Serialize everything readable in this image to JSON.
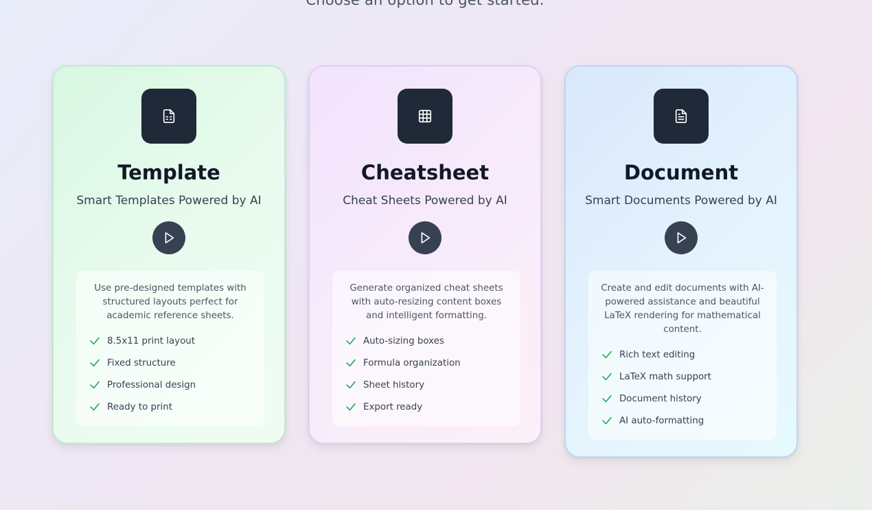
{
  "header": {
    "subtitle": "Choose an option to get started."
  },
  "cards": [
    {
      "title": "Template",
      "tagline": "Smart Templates Powered by AI",
      "icon": "file-spreadsheet-icon",
      "description": "Use pre-designed templates with structured layouts perfect for academic reference sheets.",
      "features": [
        "8.5x11 print layout",
        "Fixed structure",
        "Professional design",
        "Ready to print"
      ]
    },
    {
      "title": "Cheatsheet",
      "tagline": "Cheat Sheets Powered by AI",
      "icon": "grid-table-icon",
      "description": "Generate organized cheat sheets with auto-resizing content boxes and intelligent formatting.",
      "features": [
        "Auto-sizing boxes",
        "Formula organization",
        "Sheet history",
        "Export ready"
      ]
    },
    {
      "title": "Document",
      "tagline": "Smart Documents Powered by AI",
      "icon": "file-text-icon",
      "description": "Create and edit documents with AI-powered assistance and beautiful LaTeX rendering for mathematical content.",
      "features": [
        "Rich text editing",
        "LaTeX math support",
        "Document history",
        "AI auto-formatting"
      ]
    }
  ],
  "colors": {
    "icon_box": "#1f2937",
    "play_button": "#374151",
    "check": "#16a34a",
    "template_border": "#bdeccc",
    "cheatsheet_border": "#e3cdf5",
    "document_border": "#bcd6f5"
  }
}
